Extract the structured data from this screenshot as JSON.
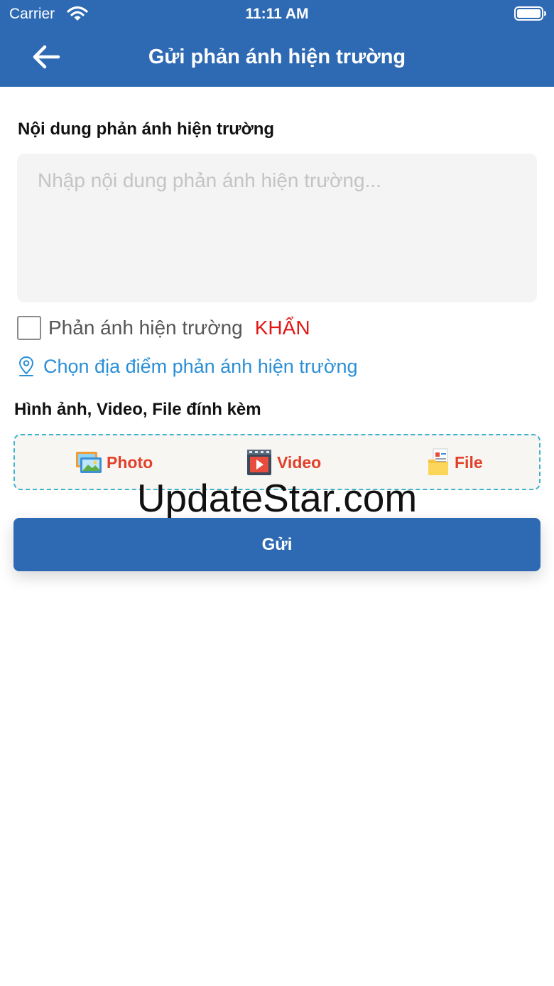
{
  "status_bar": {
    "carrier": "Carrier",
    "time": "11:11 AM"
  },
  "header": {
    "title": "Gửi phản ánh hiện trường"
  },
  "content": {
    "label": "Nội dung phản ánh hiện trường",
    "placeholder": "Nhập nội dung phản ánh hiện trường...",
    "value": ""
  },
  "urgent": {
    "label": "Phản ánh hiện trường",
    "tag": "KHẨN",
    "checked": false
  },
  "location": {
    "label": "Chọn địa điểm phản ánh hiện trường"
  },
  "attachments": {
    "label": "Hình ảnh, Video, File đính kèm",
    "photo": "Photo",
    "video": "Video",
    "file": "File"
  },
  "watermark": "UpdateStar.com",
  "submit": {
    "label": "Gửi"
  },
  "colors": {
    "header": "#2e6ab3",
    "urgent": "#e01818",
    "link": "#2b8fd6",
    "attach_text": "#e2402b",
    "dashed_border": "#3fb2cf"
  }
}
